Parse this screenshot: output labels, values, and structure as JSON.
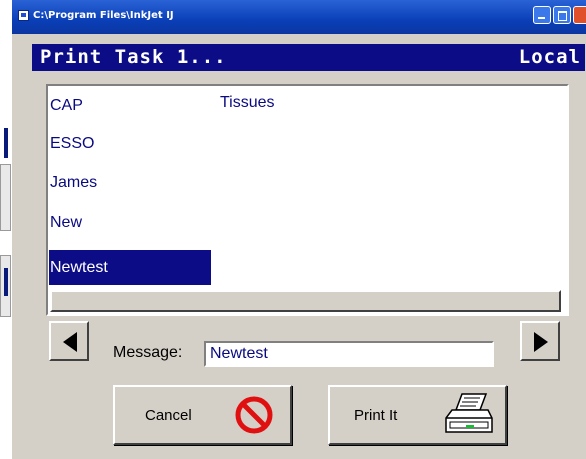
{
  "window": {
    "title": "C:\\Program Files\\InkJet  IJ"
  },
  "header": {
    "task": "Print Task 1...",
    "location": "Local"
  },
  "list": {
    "items": [
      "CAP",
      "ESSO",
      "James",
      "New",
      "Newtest"
    ],
    "selected_index": 4,
    "second_column": [
      "Tissues"
    ]
  },
  "message": {
    "label": "Message:",
    "value": "Newtest"
  },
  "buttons": {
    "cancel": "Cancel",
    "print": "Print It"
  },
  "icons": {
    "cancel": "no-entry-icon",
    "print": "printer-icon",
    "prev": "triangle-left-icon",
    "next": "triangle-right-icon"
  },
  "colors": {
    "header_bg": "#0c0c86",
    "list_text": "#0a0a80",
    "cancel_icon": "#e01010"
  }
}
